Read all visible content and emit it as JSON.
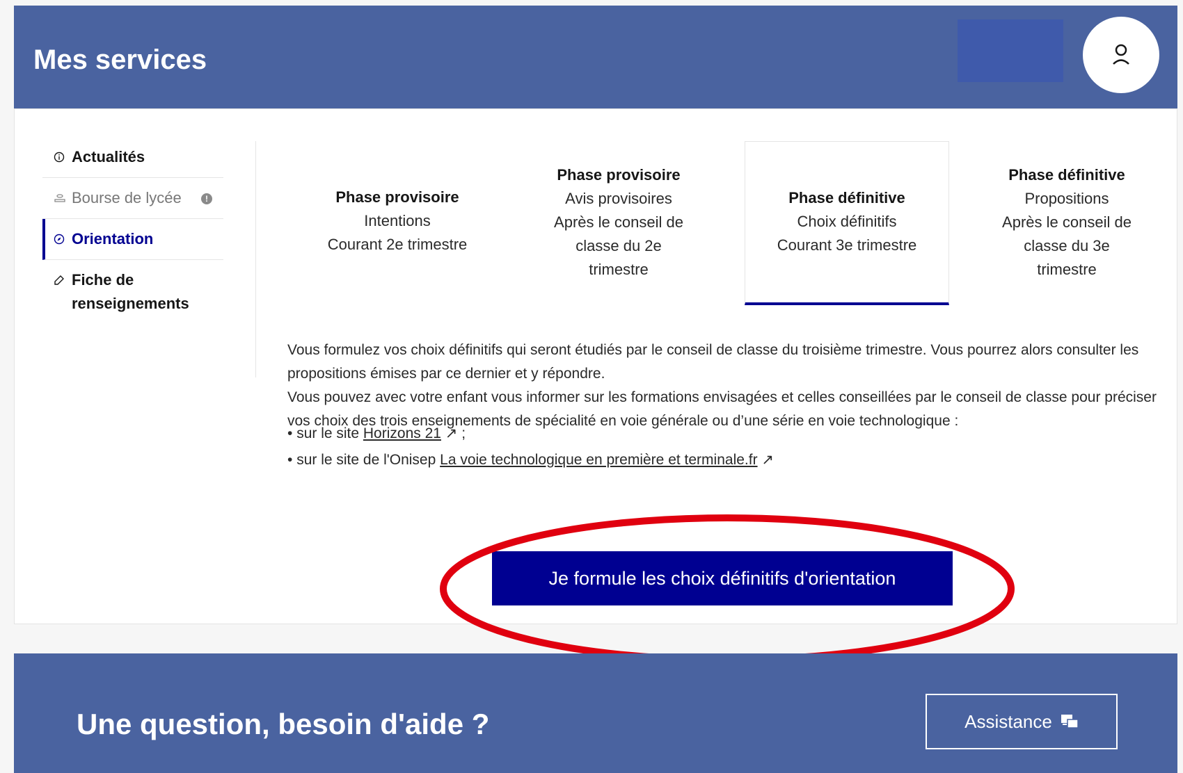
{
  "header": {
    "title": "Mes services",
    "avatar_icon": "user-icon"
  },
  "sidebar": {
    "items": [
      {
        "label": "Actualités",
        "icon": "info-circle-icon"
      },
      {
        "label": "Bourse de lycée",
        "icon": "coins-icon",
        "badge_icon": "info-dot-icon"
      },
      {
        "label": "Orientation",
        "icon": "compass-icon",
        "active": true
      },
      {
        "label": "Fiche de renseignements",
        "icon": "edit-icon"
      }
    ]
  },
  "phases": [
    {
      "title": "Phase provisoire",
      "lines": [
        "Intentions",
        "Courant 2e trimestre"
      ]
    },
    {
      "title": "Phase provisoire",
      "lines": [
        "Avis provisoires",
        "Après le conseil de",
        "classe du 2e",
        "trimestre"
      ]
    },
    {
      "title": "Phase définitive",
      "lines": [
        "Choix définitifs",
        "Courant 3e trimestre"
      ],
      "selected": true
    },
    {
      "title": "Phase définitive",
      "lines": [
        "Propositions",
        "Après le conseil de",
        "classe du 3e",
        "trimestre"
      ]
    }
  ],
  "description": {
    "p1": "Vous formulez vos choix définitifs qui seront étudiés par le conseil de classe du troisième trimestre. Vous pourrez alors consulter les propositions émises par ce dernier et y répondre.",
    "p2": "Vous pouvez avec votre enfant vous informer sur les formations envisagées et celles conseillées par le conseil de classe pour préciser vos choix des trois enseignements de spécialité en voie générale ou d’une série en voie technologique :"
  },
  "links": [
    {
      "prefix": "sur le site ",
      "link": "Horizons 21",
      "suffix": " ;"
    },
    {
      "prefix": "sur le site de l'Onisep ",
      "link": "La voie technologique en première et terminale.fr",
      "suffix": ""
    }
  ],
  "cta": {
    "label": "Je formule les choix définitifs d'orientation"
  },
  "footer": {
    "title": "Une question, besoin d'aide ?",
    "assist_label": "Assistance"
  },
  "colors": {
    "header_bg": "#4a63a0",
    "primary": "#000091",
    "highlight": "#e0000f"
  }
}
